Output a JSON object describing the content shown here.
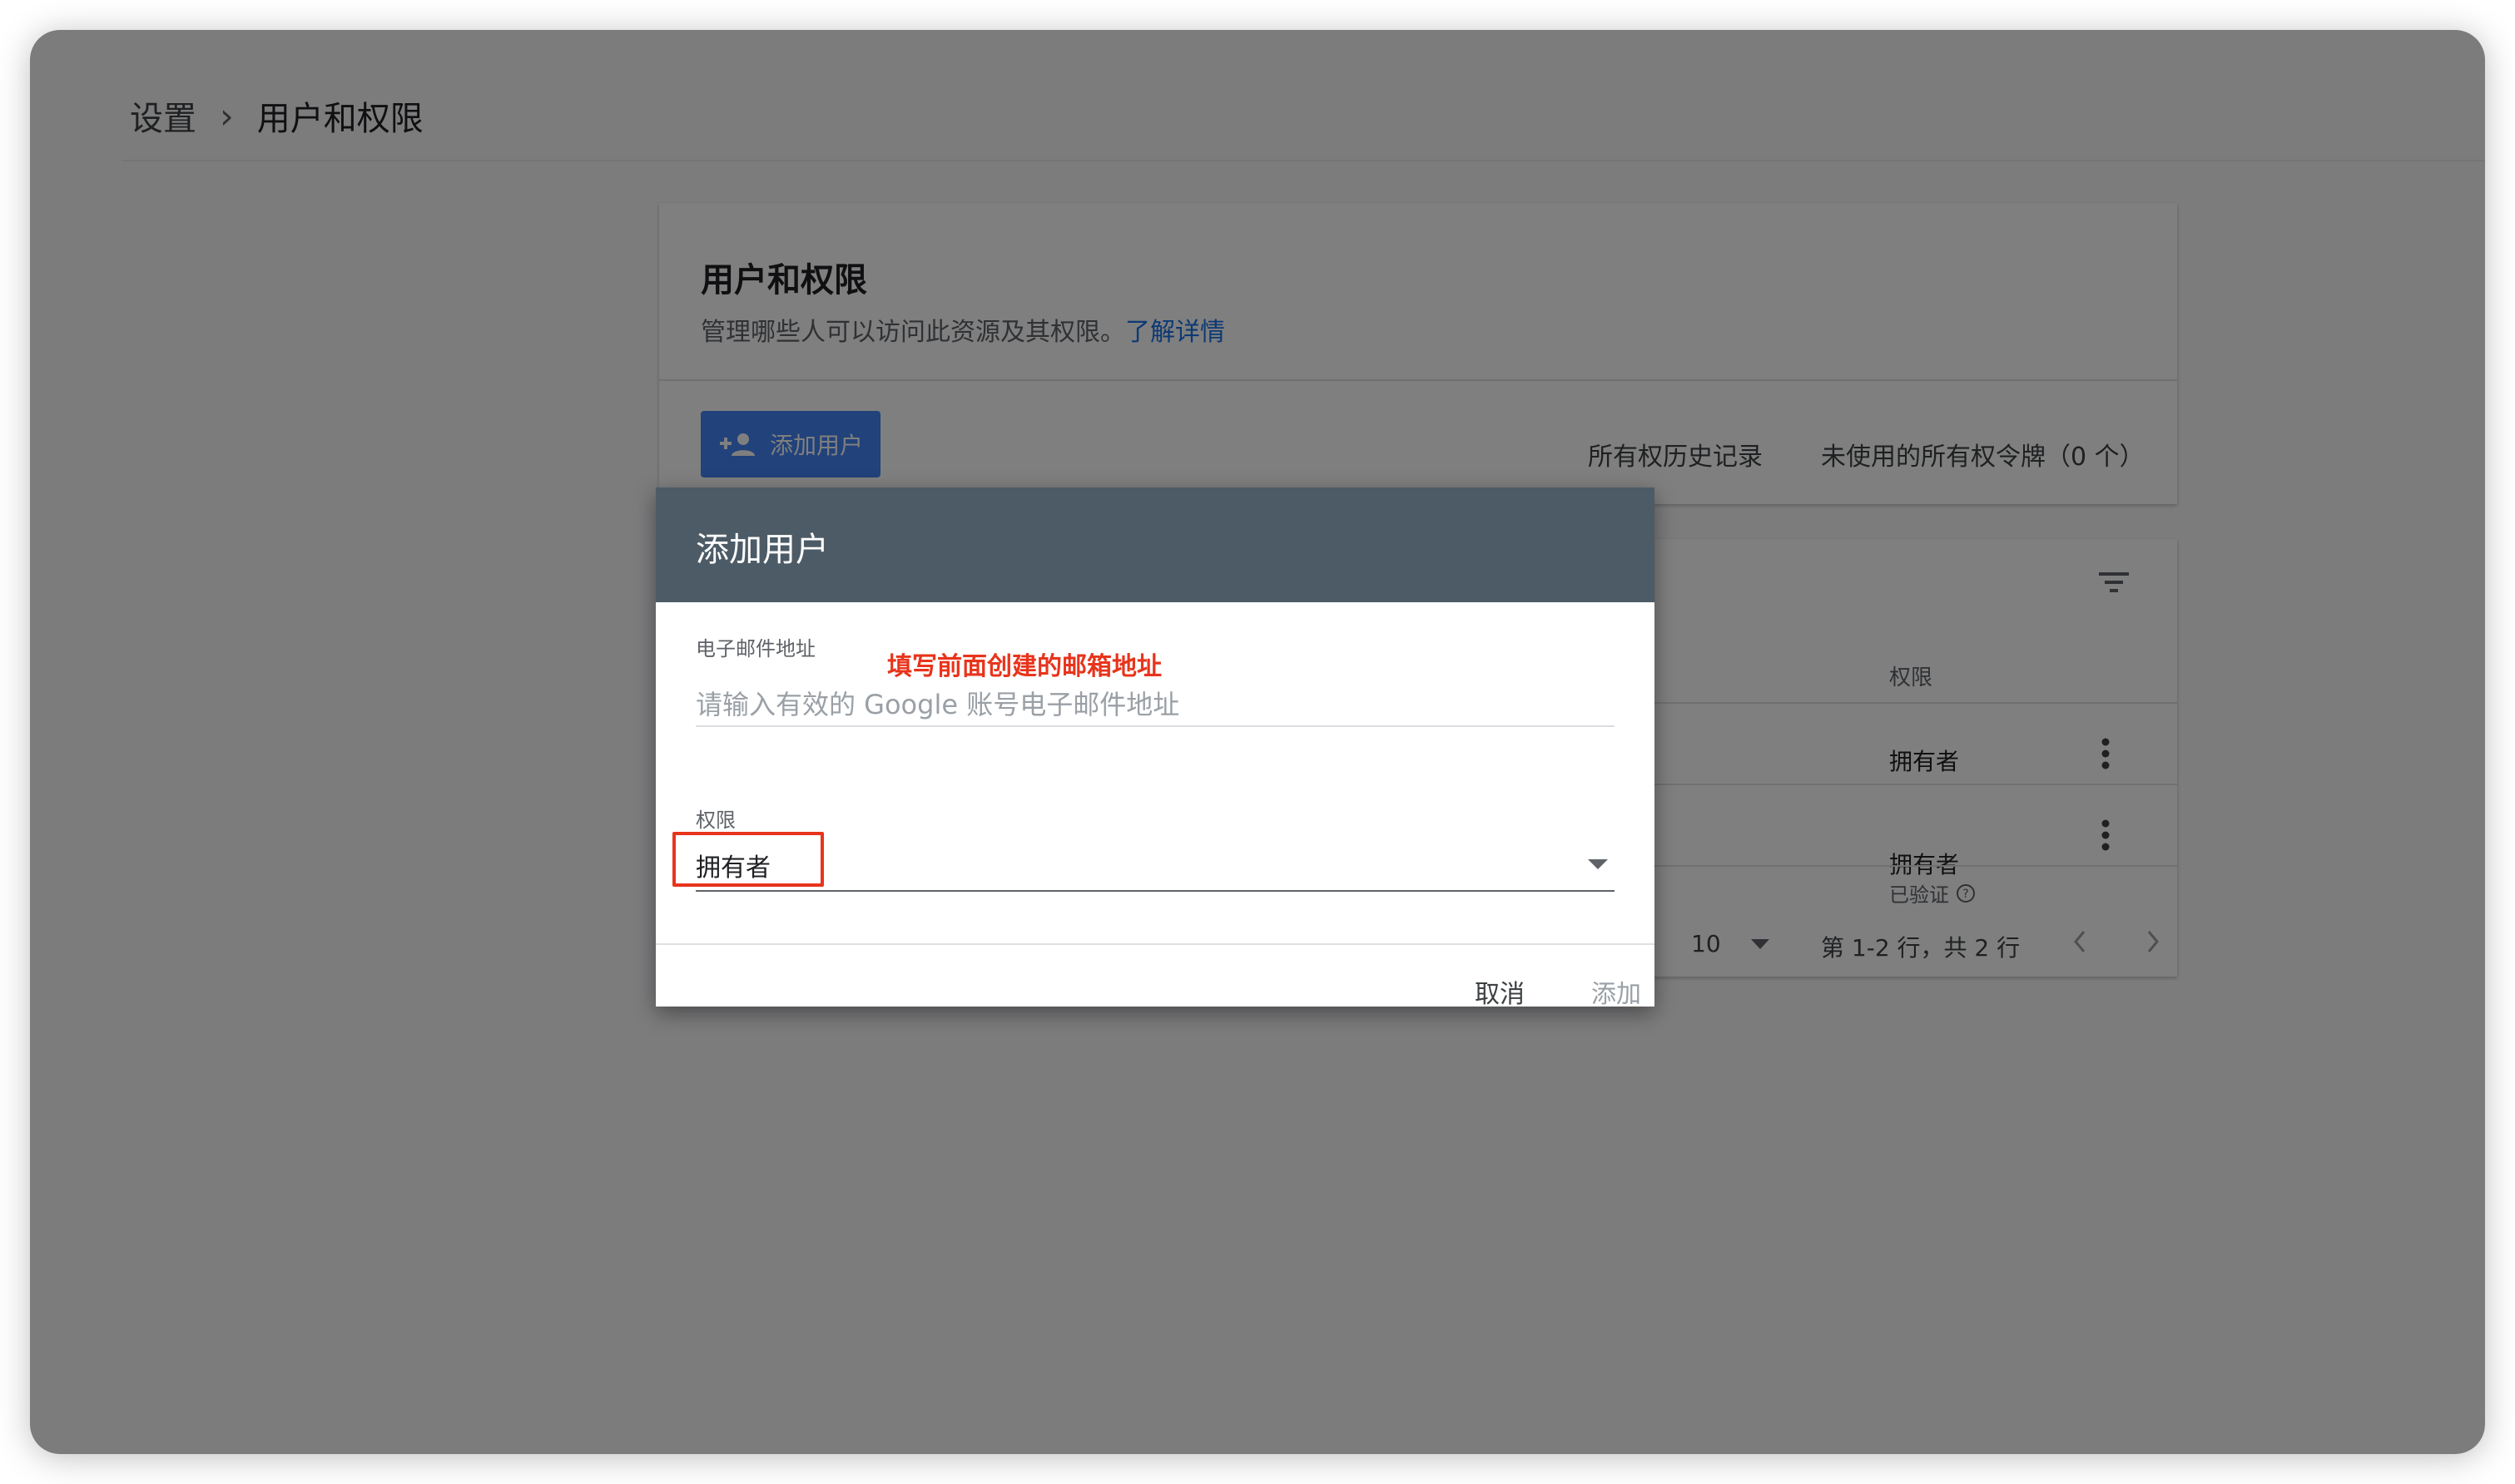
{
  "breadcrumb": {
    "parent": "设置",
    "separator": "›",
    "current": "用户和权限"
  },
  "header_card": {
    "title": "用户和权限",
    "description": "管理哪些人可以访问此资源及其权限。",
    "learn_more": "了解详情",
    "add_user_button": "添加用户",
    "ownership_history": "所有权历史记录",
    "unused_tokens": "未使用的所有权令牌（0 个）"
  },
  "table_card": {
    "column_permission": "权限",
    "rows": [
      {
        "permission": "拥有者",
        "sub": ""
      },
      {
        "permission": "拥有者",
        "sub": "已验证"
      }
    ],
    "rows_per_page": "10",
    "page_info": "第 1-2 行，共 2 行"
  },
  "dialog": {
    "title": "添加用户",
    "email_label": "电子邮件地址",
    "email_placeholder": "请输入有效的 Google 账号电子邮件地址",
    "email_value": "",
    "permission_label": "权限",
    "permission_value": "拥有者",
    "cancel_button": "取消",
    "add_button": "添加"
  },
  "annotation": {
    "text": "填写前面创建的邮箱地址",
    "color": "#e8341c"
  },
  "colors": {
    "accent": "#4285f4",
    "dialog_header": "#4c5b66",
    "link": "#1a73e8"
  }
}
